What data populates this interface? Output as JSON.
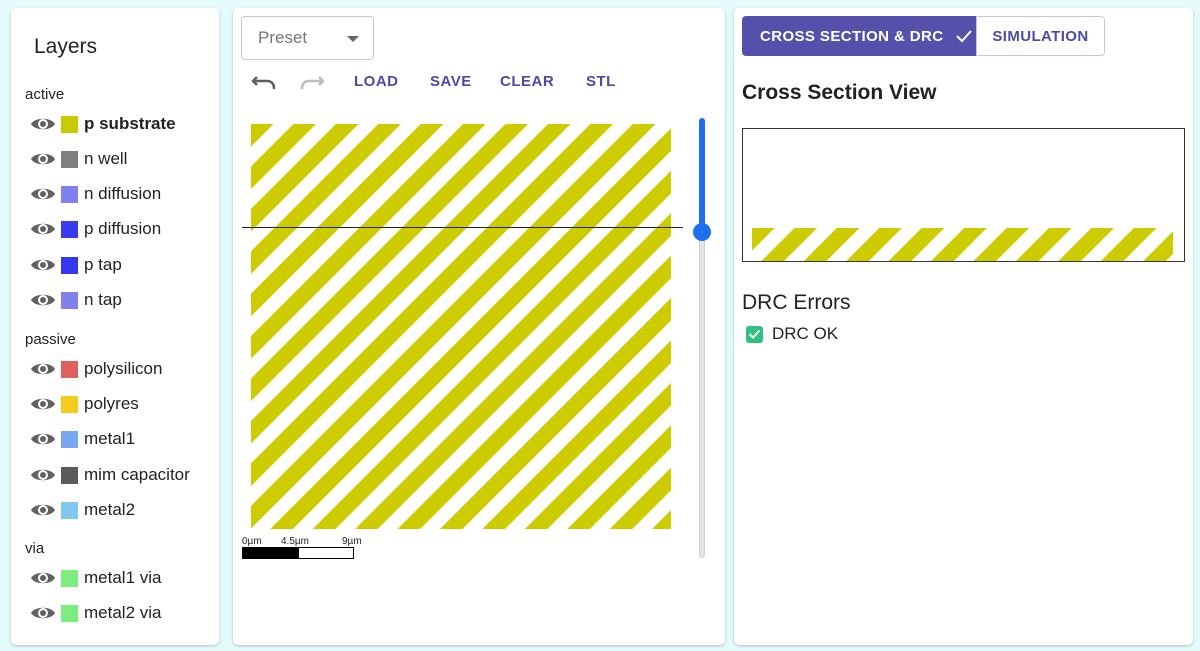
{
  "layers_panel": {
    "title": "Layers",
    "groups": [
      {
        "label": "active",
        "layers": [
          {
            "label": "p substrate",
            "color": "#c9c900",
            "selected": true
          },
          {
            "label": "n well",
            "color": "#7f7f7f"
          },
          {
            "label": "n diffusion",
            "color": "#8080ee"
          },
          {
            "label": "p diffusion",
            "color": "#3a3aee"
          },
          {
            "label": "p tap",
            "color": "#3636f0"
          },
          {
            "label": "n tap",
            "color": "#8080ee"
          }
        ]
      },
      {
        "label": "passive",
        "layers": [
          {
            "label": "polysilicon",
            "color": "#e06060"
          },
          {
            "label": "polyres",
            "color": "#f5cc1b"
          },
          {
            "label": "metal1",
            "color": "#79a8ee"
          },
          {
            "label": "mim capacitor",
            "color": "#5a5a5a"
          },
          {
            "label": "metal2",
            "color": "#80c8f2"
          }
        ]
      },
      {
        "label": "via",
        "layers": [
          {
            "label": "metal1 via",
            "color": "#7dee7d"
          },
          {
            "label": "metal2 via",
            "color": "#7dee7d"
          }
        ]
      }
    ],
    "eye_icon": "eye-icon"
  },
  "editor": {
    "preset_placeholder": "Preset",
    "undo_icon": "undo-icon",
    "redo_icon": "redo-icon",
    "buttons": {
      "load": "LOAD",
      "save": "SAVE",
      "clear": "CLEAR",
      "stl": "STL"
    },
    "canvas_fill_color": "#cccc00",
    "slider_color": "#1e6ff0",
    "scale": {
      "labels": [
        "0µm",
        "4.5µm",
        "9µm"
      ]
    }
  },
  "right_panel": {
    "tabs": {
      "cross_section": "CROSS SECTION & DRC",
      "simulation": "SIMULATION"
    },
    "active_tab_color": "#5650ad",
    "cross_section_title": "Cross Section View",
    "drc_title": "DRC Errors",
    "drc_status": "DRC OK",
    "drc_ok_color": "#2ec27e"
  }
}
